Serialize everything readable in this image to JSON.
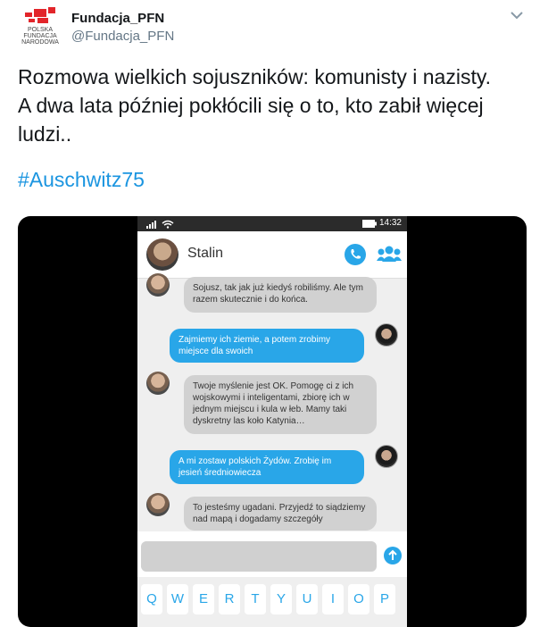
{
  "author": {
    "display_name": "Fundacja_PFN",
    "handle": "@Fundacja_PFN",
    "logo_text_lines": [
      "POLSKA",
      "FUNDACJA",
      "NARODOWA"
    ]
  },
  "tweet": {
    "text_lines": [
      "Rozmowa wielkich sojuszników: komunisty i nazisty.",
      "A dwa lata później pokłócili się o to, kto zabił więcej",
      "ludzi.."
    ],
    "hashtag": "#Auschwitz75"
  },
  "phone": {
    "time": "14:32",
    "contact_name": "Stalin",
    "messages": [
      {
        "from": "stalin",
        "text": "Sojusz, tak jak już kiedyś robiliśmy. Ale tym razem skutecznie i do końca."
      },
      {
        "from": "hitler",
        "text": "Zajmiemy ich ziemie, a potem zrobimy miejsce dla swoich"
      },
      {
        "from": "stalin",
        "text": "Twoje myślenie jest OK. Pomogę ci z ich wojskowymi i inteligentami, zbiorę ich w jednym miejscu i kula w łeb. Mamy taki dyskretny las koło Katynia…"
      },
      {
        "from": "hitler",
        "text": "A mi zostaw polskich Żydów. Zrobię im jesień średniowiecza"
      },
      {
        "from": "stalin",
        "text": "To jesteśmy ugadani. Przyjedź to siądziemy nad mapą i dogadamy szczegóły"
      }
    ],
    "keyboard_keys": [
      "Q",
      "W",
      "E",
      "R",
      "T",
      "Y",
      "U",
      "I",
      "O",
      "P"
    ]
  },
  "colors": {
    "hashtag": "#1b95e0",
    "outgoing_bubble": "#29a6e8",
    "incoming_bubble": "#d1d1d1",
    "logo_red": "#e2252a"
  }
}
